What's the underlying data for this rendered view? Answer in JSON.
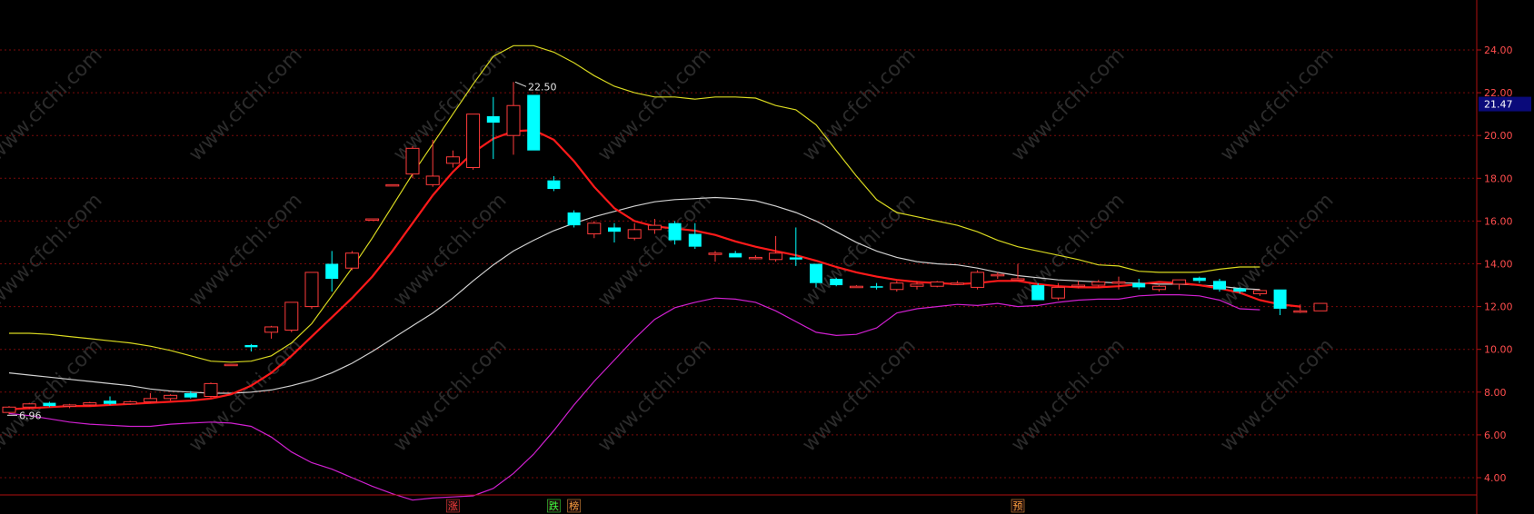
{
  "watermark": "www.cfchi.com",
  "colors": {
    "background": "#000000",
    "grid": "#7a0a0a",
    "axis": "#b01010",
    "tick_text": "#ff4d4d",
    "up_candle": "#ff3b3b",
    "down_candle": "#00ffff",
    "upper_band": "#d8d820",
    "middle_band": "#d0d0d0",
    "lower_band": "#d020d0",
    "ma_line": "#ff1a1a",
    "price_tag_bg": "#0a0a7a",
    "price_tag_text": "#ffffff"
  },
  "chart_data": {
    "type": "candlestick",
    "title": "",
    "xlabel": "",
    "ylabel": "",
    "ylim": [
      2.0,
      24.0
    ],
    "yticks": [
      "24.00",
      "22.00",
      "20.00",
      "18.00",
      "16.00",
      "14.00",
      "12.00",
      "10.00",
      "8.00",
      "6.00",
      "4.00"
    ],
    "current_price_label": "21.47",
    "annotations": {
      "high": "22.50",
      "low": "6.96"
    },
    "bottom_markers": [
      {
        "text": "涨",
        "index": 22,
        "color": "#ff4040"
      },
      {
        "text": "跌",
        "index": 27,
        "color": "#40ff40"
      },
      {
        "text": "榜",
        "index": 28,
        "color": "#ffa040"
      },
      {
        "text": "预",
        "index": 50,
        "color": "#ffa040"
      }
    ],
    "candles": [
      {
        "o": 7.05,
        "h": 7.35,
        "l": 6.96,
        "c": 7.3
      },
      {
        "o": 7.3,
        "h": 7.5,
        "l": 7.2,
        "c": 7.45
      },
      {
        "o": 7.5,
        "h": 7.55,
        "l": 7.3,
        "c": 7.35
      },
      {
        "o": 7.35,
        "h": 7.45,
        "l": 7.25,
        "c": 7.4
      },
      {
        "o": 7.4,
        "h": 7.55,
        "l": 7.35,
        "c": 7.5
      },
      {
        "o": 7.6,
        "h": 7.8,
        "l": 7.4,
        "c": 7.45
      },
      {
        "o": 7.45,
        "h": 7.6,
        "l": 7.4,
        "c": 7.55
      },
      {
        "o": 7.55,
        "h": 7.95,
        "l": 7.5,
        "c": 7.7
      },
      {
        "o": 7.7,
        "h": 7.9,
        "l": 7.6,
        "c": 7.85
      },
      {
        "o": 7.95,
        "h": 8.05,
        "l": 7.7,
        "c": 7.75
      },
      {
        "o": 7.8,
        "h": 8.45,
        "l": 7.75,
        "c": 8.4
      },
      {
        "o": 9.3,
        "h": 9.3,
        "l": 9.3,
        "c": 9.3
      },
      {
        "o": 10.2,
        "h": 10.25,
        "l": 9.9,
        "c": 10.1
      },
      {
        "o": 10.8,
        "h": 11.1,
        "l": 10.5,
        "c": 11.05
      },
      {
        "o": 10.9,
        "h": 12.2,
        "l": 10.8,
        "c": 12.2
      },
      {
        "o": 12.0,
        "h": 13.6,
        "l": 11.9,
        "c": 13.6
      },
      {
        "o": 14.0,
        "h": 14.6,
        "l": 12.7,
        "c": 13.3
      },
      {
        "o": 13.8,
        "h": 14.6,
        "l": 13.7,
        "c": 14.5
      },
      {
        "o": 16.1,
        "h": 16.1,
        "l": 16.1,
        "c": 16.1
      },
      {
        "o": 17.7,
        "h": 17.7,
        "l": 17.7,
        "c": 17.7
      },
      {
        "o": 18.2,
        "h": 19.5,
        "l": 18.0,
        "c": 19.4
      },
      {
        "o": 17.7,
        "h": 19.8,
        "l": 17.6,
        "c": 18.1
      },
      {
        "o": 18.7,
        "h": 19.3,
        "l": 18.5,
        "c": 19.0
      },
      {
        "o": 18.5,
        "h": 20.4,
        "l": 18.4,
        "c": 21.0
      },
      {
        "o": 20.9,
        "h": 21.8,
        "l": 18.9,
        "c": 20.6
      },
      {
        "o": 20.0,
        "h": 22.5,
        "l": 19.1,
        "c": 21.4
      },
      {
        "o": 21.9,
        "h": 21.9,
        "l": 19.3,
        "c": 19.3
      },
      {
        "o": 17.9,
        "h": 18.1,
        "l": 17.4,
        "c": 17.5
      },
      {
        "o": 16.4,
        "h": 16.5,
        "l": 15.7,
        "c": 15.8
      },
      {
        "o": 15.4,
        "h": 16.0,
        "l": 15.2,
        "c": 15.9
      },
      {
        "o": 15.7,
        "h": 15.9,
        "l": 15.0,
        "c": 15.5
      },
      {
        "o": 15.2,
        "h": 15.9,
        "l": 15.1,
        "c": 15.6
      },
      {
        "o": 15.6,
        "h": 16.1,
        "l": 15.4,
        "c": 15.8
      },
      {
        "o": 15.9,
        "h": 16.0,
        "l": 14.9,
        "c": 15.1
      },
      {
        "o": 15.4,
        "h": 15.9,
        "l": 14.7,
        "c": 14.8
      },
      {
        "o": 14.5,
        "h": 14.6,
        "l": 14.1,
        "c": 14.5
      },
      {
        "o": 14.5,
        "h": 14.6,
        "l": 14.3,
        "c": 14.3
      },
      {
        "o": 14.3,
        "h": 14.4,
        "l": 14.2,
        "c": 14.3
      },
      {
        "o": 14.2,
        "h": 15.3,
        "l": 14.1,
        "c": 14.5
      },
      {
        "o": 14.3,
        "h": 15.7,
        "l": 13.9,
        "c": 14.2
      },
      {
        "o": 14.0,
        "h": 14.0,
        "l": 12.9,
        "c": 13.1
      },
      {
        "o": 13.3,
        "h": 13.35,
        "l": 12.95,
        "c": 13.0
      },
      {
        "o": 12.95,
        "h": 13.0,
        "l": 12.9,
        "c": 12.95
      },
      {
        "o": 12.95,
        "h": 13.1,
        "l": 12.8,
        "c": 12.9
      },
      {
        "o": 12.8,
        "h": 13.2,
        "l": 12.7,
        "c": 13.1
      },
      {
        "o": 12.95,
        "h": 13.2,
        "l": 12.8,
        "c": 13.05
      },
      {
        "o": 12.95,
        "h": 13.2,
        "l": 12.9,
        "c": 13.15
      },
      {
        "o": 13.05,
        "h": 13.2,
        "l": 13.0,
        "c": 13.1
      },
      {
        "o": 12.9,
        "h": 13.7,
        "l": 12.8,
        "c": 13.6
      },
      {
        "o": 13.5,
        "h": 13.6,
        "l": 13.3,
        "c": 13.5
      },
      {
        "o": 13.3,
        "h": 14.0,
        "l": 13.2,
        "c": 13.3
      },
      {
        "o": 13.0,
        "h": 13.1,
        "l": 12.3,
        "c": 12.3
      },
      {
        "o": 12.4,
        "h": 13.1,
        "l": 12.3,
        "c": 12.9
      },
      {
        "o": 12.95,
        "h": 13.2,
        "l": 12.85,
        "c": 13.0
      },
      {
        "o": 13.0,
        "h": 13.25,
        "l": 12.9,
        "c": 13.15
      },
      {
        "o": 13.1,
        "h": 13.4,
        "l": 12.8,
        "c": 13.15
      },
      {
        "o": 13.1,
        "h": 13.3,
        "l": 12.8,
        "c": 12.9
      },
      {
        "o": 12.8,
        "h": 13.0,
        "l": 12.7,
        "c": 12.95
      },
      {
        "o": 13.05,
        "h": 13.2,
        "l": 12.8,
        "c": 13.25
      },
      {
        "o": 13.35,
        "h": 13.4,
        "l": 13.1,
        "c": 13.2
      },
      {
        "o": 13.2,
        "h": 13.3,
        "l": 12.7,
        "c": 12.8
      },
      {
        "o": 12.85,
        "h": 12.9,
        "l": 12.6,
        "c": 12.7
      },
      {
        "o": 12.6,
        "h": 12.8,
        "l": 12.5,
        "c": 12.75
      },
      {
        "o": 12.8,
        "h": 12.8,
        "l": 11.6,
        "c": 11.9
      },
      {
        "o": 11.8,
        "h": 12.1,
        "l": 11.7,
        "c": 11.8
      },
      {
        "o": 11.8,
        "h": 12.15,
        "l": 11.8,
        "c": 12.15
      }
    ],
    "series": [
      {
        "name": "",
        "role": "upper",
        "values": [
          10.75,
          10.75,
          10.7,
          10.6,
          10.5,
          10.4,
          10.3,
          10.15,
          9.95,
          9.7,
          9.45,
          9.4,
          9.45,
          9.7,
          10.3,
          11.2,
          12.5,
          13.8,
          15.2,
          16.7,
          18.2,
          19.6,
          21.0,
          22.4,
          23.7,
          24.2,
          24.2,
          23.9,
          23.4,
          22.8,
          22.3,
          22.0,
          21.8,
          21.8,
          21.7,
          21.8,
          21.8,
          21.75,
          21.4,
          21.2,
          20.5,
          19.3,
          18.1,
          17.0,
          16.4,
          16.2,
          16.0,
          15.8,
          15.5,
          15.1,
          14.8,
          14.6,
          14.4,
          14.2,
          13.95,
          13.9,
          13.65,
          13.6,
          13.6,
          13.6,
          13.75,
          13.85,
          13.85
        ]
      },
      {
        "name": "",
        "role": "middle",
        "values": [
          8.9,
          8.8,
          8.7,
          8.6,
          8.5,
          8.4,
          8.3,
          8.15,
          8.05,
          8.0,
          7.95,
          7.95,
          8.0,
          8.1,
          8.3,
          8.55,
          8.9,
          9.35,
          9.9,
          10.5,
          11.1,
          11.7,
          12.4,
          13.2,
          13.95,
          14.6,
          15.1,
          15.55,
          15.9,
          16.2,
          16.45,
          16.7,
          16.9,
          17.0,
          17.05,
          17.1,
          17.05,
          16.95,
          16.7,
          16.4,
          16.0,
          15.5,
          15.0,
          14.6,
          14.3,
          14.1,
          14.0,
          13.95,
          13.8,
          13.6,
          13.45,
          13.35,
          13.25,
          13.2,
          13.15,
          13.1,
          13.1,
          13.05,
          13.05,
          13.0,
          12.95,
          12.85,
          12.8
        ]
      },
      {
        "name": "",
        "role": "lower",
        "values": [
          7.0,
          6.9,
          6.75,
          6.6,
          6.5,
          6.45,
          6.4,
          6.4,
          6.5,
          6.55,
          6.6,
          6.55,
          6.4,
          5.9,
          5.2,
          4.7,
          4.4,
          4.0,
          3.6,
          3.25,
          2.95,
          3.05,
          3.1,
          3.15,
          3.5,
          4.2,
          5.1,
          6.2,
          7.4,
          8.5,
          9.5,
          10.5,
          11.4,
          11.95,
          12.2,
          12.4,
          12.35,
          12.2,
          11.8,
          11.3,
          10.8,
          10.65,
          10.7,
          11.0,
          11.7,
          11.9,
          12.0,
          12.1,
          12.05,
          12.15,
          12.0,
          12.05,
          12.2,
          12.3,
          12.35,
          12.35,
          12.5,
          12.55,
          12.55,
          12.5,
          12.3,
          11.9,
          11.85
        ]
      },
      {
        "name": "",
        "role": "ma",
        "values": [
          7.2,
          7.25,
          7.3,
          7.35,
          7.35,
          7.4,
          7.45,
          7.5,
          7.55,
          7.6,
          7.7,
          7.9,
          8.3,
          8.9,
          9.7,
          10.6,
          11.5,
          12.4,
          13.4,
          14.6,
          15.9,
          17.2,
          18.3,
          19.2,
          19.85,
          20.2,
          20.25,
          19.8,
          18.8,
          17.6,
          16.6,
          16.0,
          15.75,
          15.65,
          15.55,
          15.35,
          15.05,
          14.8,
          14.6,
          14.4,
          14.15,
          13.85,
          13.6,
          13.4,
          13.25,
          13.15,
          13.1,
          13.05,
          13.1,
          13.2,
          13.2,
          13.05,
          12.95,
          12.9,
          12.9,
          12.95,
          13.05,
          13.15,
          13.1,
          13.0,
          12.85,
          12.65,
          12.3,
          12.1,
          12.0
        ]
      }
    ]
  }
}
